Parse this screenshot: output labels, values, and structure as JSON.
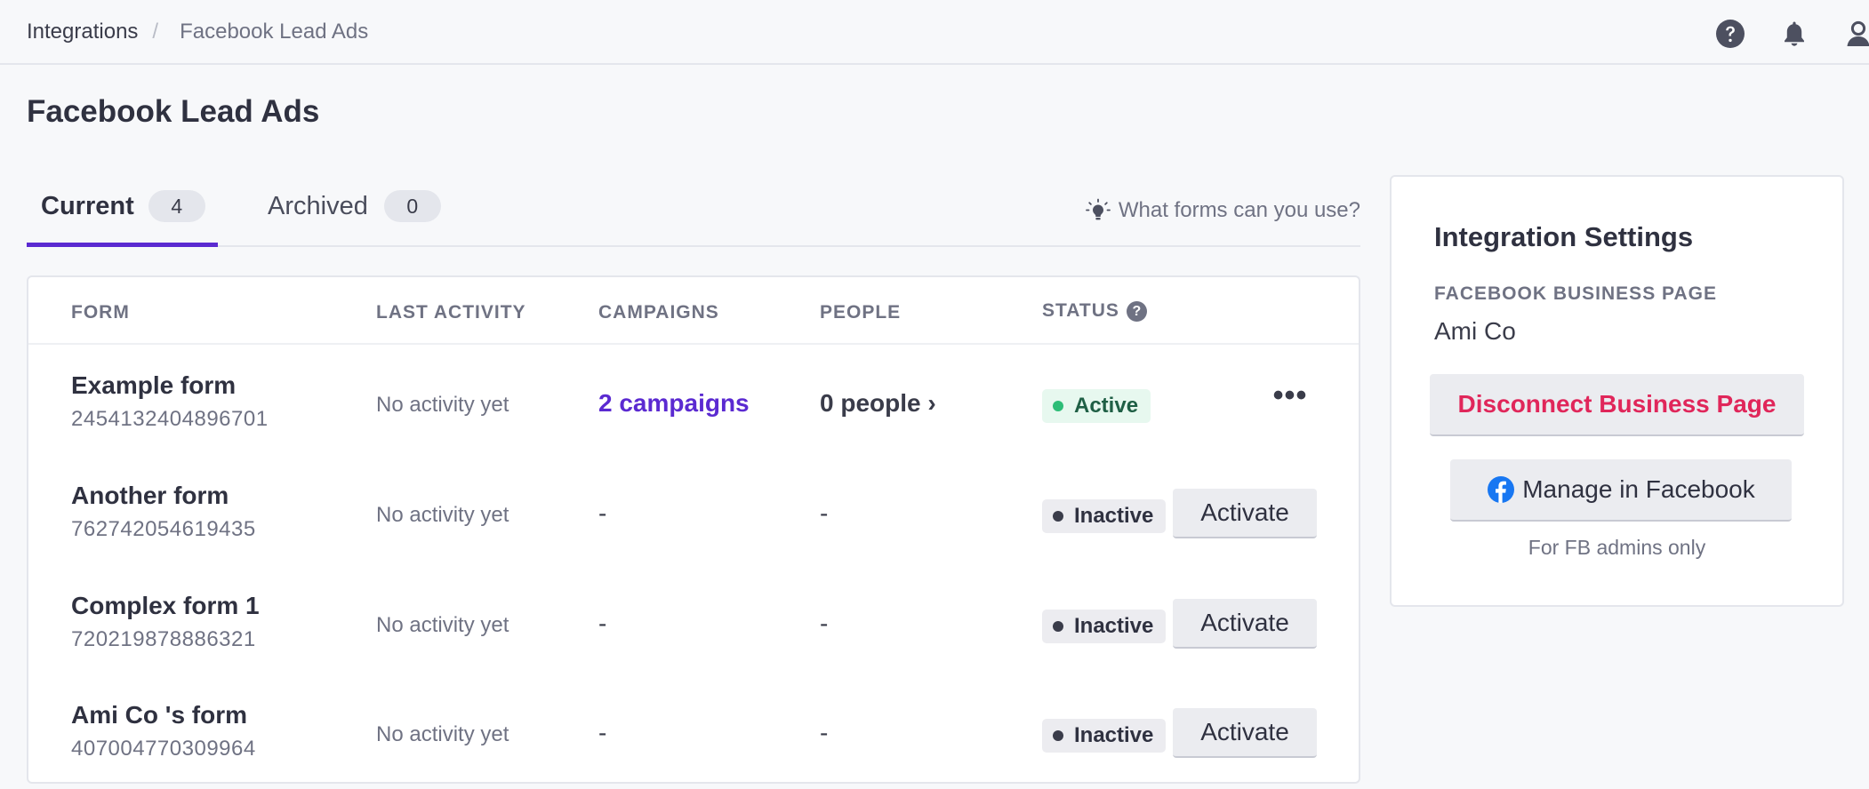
{
  "breadcrumb": {
    "parent": "Integrations",
    "separator": "/",
    "current": "Facebook Lead Ads"
  },
  "header_icons": [
    "help-icon",
    "bell-icon",
    "user-icon"
  ],
  "page": {
    "title": "Facebook Lead Ads"
  },
  "tabs": [
    {
      "label": "Current",
      "count": "4",
      "active": true
    },
    {
      "label": "Archived",
      "count": "0",
      "active": false
    }
  ],
  "help_link": {
    "icon": "lightbulb-icon",
    "label": "What forms can you use?"
  },
  "table": {
    "columns": {
      "form": "FORM",
      "last_activity": "LAST ACTIVITY",
      "campaigns": "CAMPAIGNS",
      "people": "PEOPLE",
      "status": "STATUS",
      "status_help": "?"
    },
    "rows": [
      {
        "name": "Example form",
        "id": "2454132404896701",
        "last_activity": "No activity yet",
        "campaigns": "2 campaigns",
        "people": "0 people ›",
        "status": "Active",
        "action": "•••"
      },
      {
        "name": "Another form",
        "id": "762742054619435",
        "last_activity": "No activity yet",
        "campaigns": "-",
        "people": "-",
        "status": "Inactive",
        "action": "Activate"
      },
      {
        "name": "Complex form 1",
        "id": "720219878886321",
        "last_activity": "No activity yet",
        "campaigns": "-",
        "people": "-",
        "status": "Inactive",
        "action": "Activate"
      },
      {
        "name": "Ami Co 's form",
        "id": "407004770309964",
        "last_activity": "No activity yet",
        "campaigns": "-",
        "people": "-",
        "status": "Inactive",
        "action": "Activate"
      }
    ]
  },
  "settings": {
    "title": "Integration Settings",
    "page_label": "FACEBOOK BUSINESS PAGE",
    "page_value": "Ami Co",
    "disconnect_label": "Disconnect Business Page",
    "manage_label": "Manage in Facebook",
    "manage_note": "For FB admins only"
  },
  "colors": {
    "accent": "#5b2ad1",
    "danger": "#e0265a",
    "active_badge": "#e7f8ef",
    "active_dot": "#2dbd77",
    "facebook_blue": "#1877f2"
  }
}
